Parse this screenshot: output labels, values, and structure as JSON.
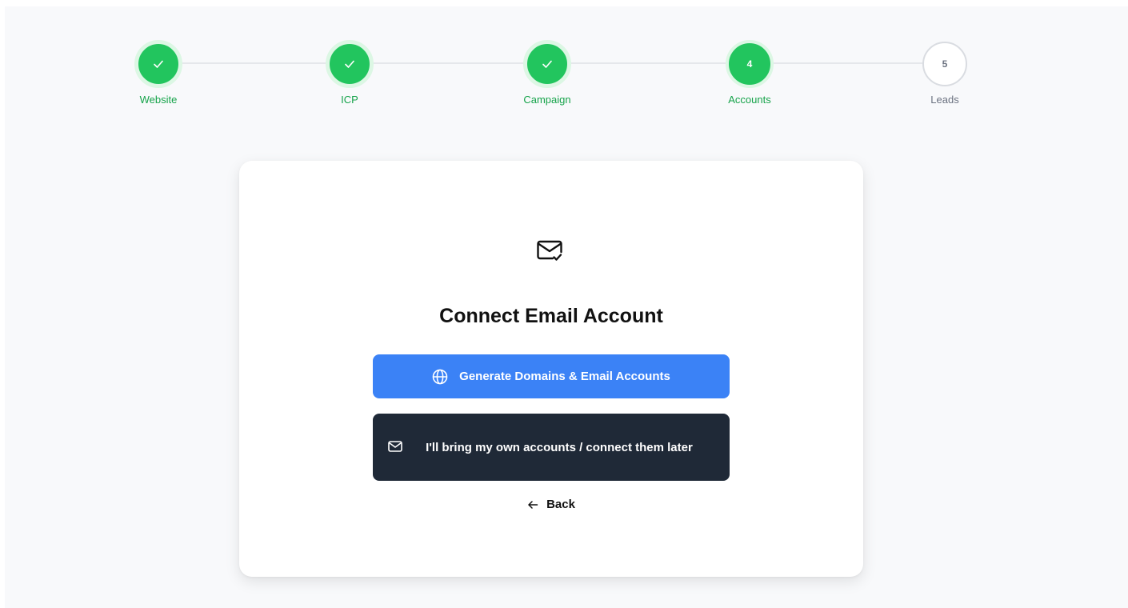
{
  "stepper": {
    "steps": [
      {
        "label": "Website",
        "state": "done",
        "icon": "check-icon"
      },
      {
        "label": "ICP",
        "state": "done",
        "icon": "check-icon"
      },
      {
        "label": "Campaign",
        "state": "done",
        "icon": "check-icon"
      },
      {
        "label": "Accounts",
        "state": "active",
        "number": "4"
      },
      {
        "label": "Leads",
        "state": "pending",
        "number": "5"
      }
    ]
  },
  "card": {
    "icon": "mail-check-icon",
    "title": "Connect Email Account",
    "primary_button": {
      "label": "Generate Domains & Email Accounts",
      "icon": "globe-icon"
    },
    "secondary_button": {
      "label": "I'll bring my own accounts / connect them later",
      "icon": "mail-icon"
    },
    "back": {
      "label": "Back",
      "icon": "arrow-left-icon"
    }
  },
  "colors": {
    "success": "#22c55e",
    "primary": "#3b82f6",
    "dark": "#1f2937",
    "background": "#f8f9fb"
  }
}
